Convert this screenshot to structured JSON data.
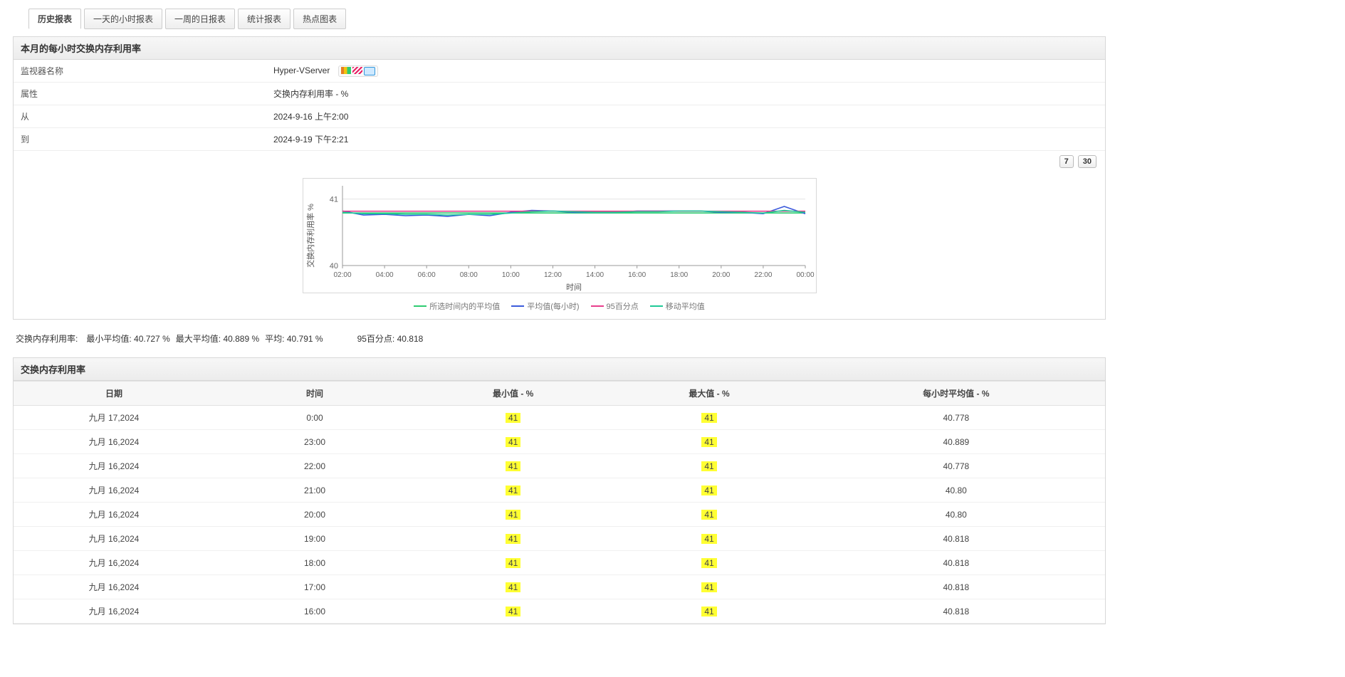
{
  "tabs": [
    {
      "label": "历史报表",
      "active": true
    },
    {
      "label": "一天的小时报表",
      "active": false
    },
    {
      "label": "一周的日报表",
      "active": false
    },
    {
      "label": "统计报表",
      "active": false
    },
    {
      "label": "热点图表",
      "active": false
    }
  ],
  "panel_title": "本月的每小时交换内存利用率",
  "info": {
    "monitor_name_label": "监视器名称",
    "monitor_name_value": "Hyper-VServer",
    "attr_label": "属性",
    "attr_value": "交换内存利用率 - %",
    "from_label": "从",
    "from_value": "2024-9-16 上午2:00",
    "to_label": "到",
    "to_value": "2024-9-19 下午2:21"
  },
  "time_buttons": {
    "seven": "7",
    "thirty": "30"
  },
  "chart_axis_y": "交换内存利用率  %",
  "chart_axis_x": "时间",
  "legend_items": [
    {
      "color": "#2ecc71",
      "text": "所选时间内的平均值"
    },
    {
      "color": "#3b5bdb",
      "text": "平均值(每小时)"
    },
    {
      "color": "#e83e8c",
      "text": "95百分点"
    },
    {
      "color": "#20c997",
      "text": "移动平均值"
    }
  ],
  "stats": {
    "metric_label": "交换内存利用率:",
    "min_avg_label": "最小平均值:",
    "min_avg_value": "40.727  %",
    "max_avg_label": "最大平均值:",
    "max_avg_value": "40.889  %",
    "avg_label": "平均:",
    "avg_value": "40.791  %",
    "p95_label": "95百分点:",
    "p95_value": "40.818"
  },
  "table": {
    "title": "交换内存利用率",
    "headers": {
      "date": "日期",
      "time": "时间",
      "min": "最小值 - %",
      "max": "最大值 - %",
      "havg": "每小时平均值 - %"
    },
    "rows": [
      {
        "date": "九月 17,2024",
        "time": "0:00",
        "min": "41",
        "max": "41",
        "havg": "40.778"
      },
      {
        "date": "九月 16,2024",
        "time": "23:00",
        "min": "41",
        "max": "41",
        "havg": "40.889"
      },
      {
        "date": "九月 16,2024",
        "time": "22:00",
        "min": "41",
        "max": "41",
        "havg": "40.778"
      },
      {
        "date": "九月 16,2024",
        "time": "21:00",
        "min": "41",
        "max": "41",
        "havg": "40.80"
      },
      {
        "date": "九月 16,2024",
        "time": "20:00",
        "min": "41",
        "max": "41",
        "havg": "40.80"
      },
      {
        "date": "九月 16,2024",
        "time": "19:00",
        "min": "41",
        "max": "41",
        "havg": "40.818"
      },
      {
        "date": "九月 16,2024",
        "time": "18:00",
        "min": "41",
        "max": "41",
        "havg": "40.818"
      },
      {
        "date": "九月 16,2024",
        "time": "17:00",
        "min": "41",
        "max": "41",
        "havg": "40.818"
      },
      {
        "date": "九月 16,2024",
        "time": "16:00",
        "min": "41",
        "max": "41",
        "havg": "40.818"
      }
    ]
  },
  "chart_data": {
    "type": "line",
    "ylabel": "交换内存利用率  %",
    "xlabel": "时间",
    "ylim": [
      40,
      41.2
    ],
    "x_ticks": [
      "02:00",
      "04:00",
      "06:00",
      "08:00",
      "10:00",
      "12:00",
      "14:00",
      "16:00",
      "18:00",
      "20:00",
      "22:00",
      "00:00"
    ],
    "x": [
      2,
      3,
      4,
      5,
      6,
      7,
      8,
      9,
      10,
      11,
      12,
      13,
      14,
      15,
      16,
      17,
      18,
      19,
      20,
      21,
      22,
      23,
      24
    ],
    "series": [
      {
        "name": "所选时间内的平均值",
        "color": "#2ecc71",
        "values": [
          40.791,
          40.791,
          40.791,
          40.791,
          40.791,
          40.791,
          40.791,
          40.791,
          40.791,
          40.791,
          40.791,
          40.791,
          40.791,
          40.791,
          40.791,
          40.791,
          40.791,
          40.791,
          40.791,
          40.791,
          40.791,
          40.791,
          40.791
        ]
      },
      {
        "name": "平均值(每小时)",
        "color": "#3b5bdb",
        "values": [
          40.82,
          40.76,
          40.77,
          40.75,
          40.76,
          40.74,
          40.77,
          40.75,
          40.8,
          40.83,
          40.82,
          40.8,
          40.8,
          40.8,
          40.82,
          40.82,
          40.82,
          40.82,
          40.8,
          40.8,
          40.78,
          40.89,
          40.78
        ]
      },
      {
        "name": "95百分点",
        "color": "#e83e8c",
        "values": [
          40.818,
          40.818,
          40.818,
          40.818,
          40.818,
          40.818,
          40.818,
          40.818,
          40.818,
          40.818,
          40.818,
          40.818,
          40.818,
          40.818,
          40.818,
          40.818,
          40.818,
          40.818,
          40.818,
          40.818,
          40.818,
          40.818,
          40.818
        ]
      },
      {
        "name": "移动平均值",
        "color": "#20c997",
        "values": [
          40.8,
          40.78,
          40.78,
          40.77,
          40.77,
          40.76,
          40.77,
          40.77,
          40.79,
          40.81,
          40.82,
          40.81,
          40.8,
          40.8,
          40.81,
          40.81,
          40.82,
          40.82,
          40.81,
          40.8,
          40.79,
          40.83,
          40.8
        ]
      }
    ]
  }
}
